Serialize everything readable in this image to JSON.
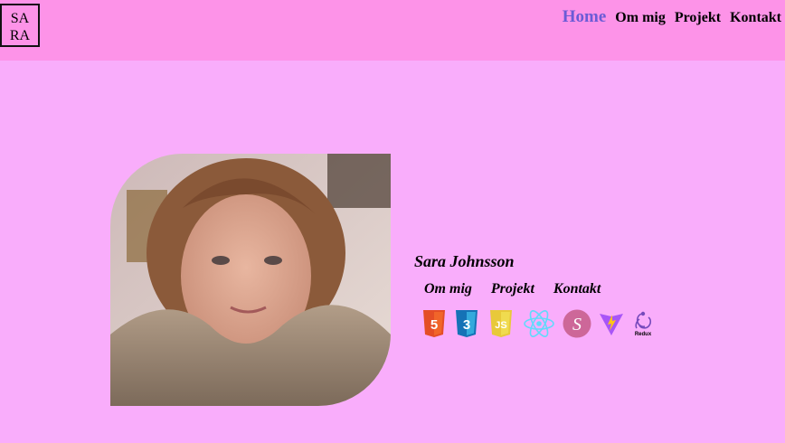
{
  "logo": {
    "line1": "SA",
    "line2": "RA"
  },
  "nav": [
    {
      "label": "Home",
      "active": true
    },
    {
      "label": "Om mig"
    },
    {
      "label": "Projekt"
    },
    {
      "label": "Kontakt"
    }
  ],
  "profile": {
    "name": "Sara Johnsson",
    "links": [
      "Om mig",
      "Projekt",
      "Kontakt"
    ],
    "photo": "profile-photo"
  },
  "tech_icons": [
    {
      "name": "html5-icon",
      "color": "#e44d26",
      "label": "5"
    },
    {
      "name": "css3-icon",
      "color": "#1572b6",
      "label": "3"
    },
    {
      "name": "javascript-icon",
      "color": "#f0db4f",
      "label": "JS"
    },
    {
      "name": "react-icon",
      "color": "#61dafb"
    },
    {
      "name": "sass-icon",
      "color": "#cd6799",
      "label": "S"
    },
    {
      "name": "vite-icon",
      "color": "#a855f7"
    },
    {
      "name": "redux-icon",
      "color": "#764abc",
      "label": "Redux"
    }
  ],
  "colors": {
    "page_bg": "#f9adfb",
    "header_bg": "#fd93e8",
    "nav_active": "#6b5bd6"
  }
}
